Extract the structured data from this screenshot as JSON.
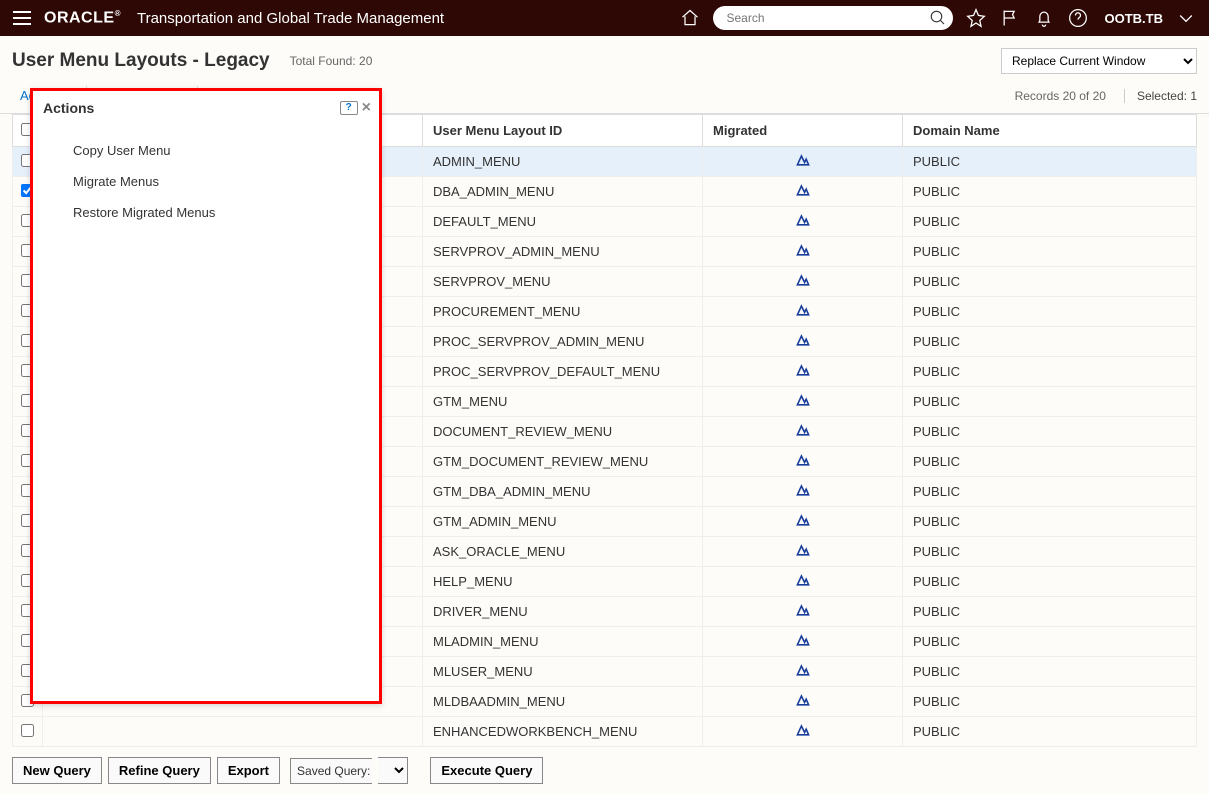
{
  "header": {
    "logo_text": "ORACLE",
    "app_title": "Transportation and Global Trade Management",
    "search_placeholder": "Search",
    "user_label": "OOTB.TB"
  },
  "page": {
    "title": "User Menu Layouts - Legacy",
    "total_found_label": "Total Found:",
    "total_found_value": "20",
    "replace_option": "Replace Current Window"
  },
  "toolbar": {
    "actions_label": "Actions",
    "records_label": "Records 20 of 20",
    "selected_label": "Selected: 1"
  },
  "actions_dropdown": {
    "title": "Actions",
    "help_label": "?",
    "items": [
      {
        "label": "Copy User Menu"
      },
      {
        "label": "Migrate Menus"
      },
      {
        "label": "Restore Migrated Menus"
      }
    ]
  },
  "table": {
    "columns": {
      "id": "User Menu Layout ID",
      "migrated": "Migrated",
      "domain": "Domain Name"
    },
    "rows": [
      {
        "checked": false,
        "id": "ADMIN_MENU",
        "migrated": true,
        "domain": "PUBLIC",
        "highlight": true
      },
      {
        "checked": true,
        "id": "DBA_ADMIN_MENU",
        "migrated": true,
        "domain": "PUBLIC",
        "highlight": false
      },
      {
        "checked": false,
        "id": "DEFAULT_MENU",
        "migrated": true,
        "domain": "PUBLIC",
        "highlight": false
      },
      {
        "checked": false,
        "id": "SERVPROV_ADMIN_MENU",
        "migrated": true,
        "domain": "PUBLIC",
        "highlight": false
      },
      {
        "checked": false,
        "id": "SERVPROV_MENU",
        "migrated": true,
        "domain": "PUBLIC",
        "highlight": false
      },
      {
        "checked": false,
        "id": "PROCUREMENT_MENU",
        "migrated": true,
        "domain": "PUBLIC",
        "highlight": false
      },
      {
        "checked": false,
        "id": "PROC_SERVPROV_ADMIN_MENU",
        "migrated": true,
        "domain": "PUBLIC",
        "highlight": false
      },
      {
        "checked": false,
        "id": "PROC_SERVPROV_DEFAULT_MENU",
        "migrated": true,
        "domain": "PUBLIC",
        "highlight": false
      },
      {
        "checked": false,
        "id": "GTM_MENU",
        "migrated": true,
        "domain": "PUBLIC",
        "highlight": false
      },
      {
        "checked": false,
        "id": "DOCUMENT_REVIEW_MENU",
        "migrated": true,
        "domain": "PUBLIC",
        "highlight": false
      },
      {
        "checked": false,
        "id": "GTM_DOCUMENT_REVIEW_MENU",
        "migrated": true,
        "domain": "PUBLIC",
        "highlight": false
      },
      {
        "checked": false,
        "id": "GTM_DBA_ADMIN_MENU",
        "migrated": true,
        "domain": "PUBLIC",
        "highlight": false
      },
      {
        "checked": false,
        "id": "GTM_ADMIN_MENU",
        "migrated": true,
        "domain": "PUBLIC",
        "highlight": false
      },
      {
        "checked": false,
        "id": "ASK_ORACLE_MENU",
        "migrated": true,
        "domain": "PUBLIC",
        "highlight": false
      },
      {
        "checked": false,
        "id": "HELP_MENU",
        "migrated": true,
        "domain": "PUBLIC",
        "highlight": false
      },
      {
        "checked": false,
        "id": "DRIVER_MENU",
        "migrated": true,
        "domain": "PUBLIC",
        "highlight": false
      },
      {
        "checked": false,
        "id": "MLADMIN_MENU",
        "migrated": true,
        "domain": "PUBLIC",
        "highlight": false
      },
      {
        "checked": false,
        "id": "MLUSER_MENU",
        "migrated": true,
        "domain": "PUBLIC",
        "highlight": false
      },
      {
        "checked": false,
        "id": "MLDBAADMIN_MENU",
        "migrated": true,
        "domain": "PUBLIC",
        "highlight": false
      },
      {
        "checked": false,
        "id": "ENHANCEDWORKBENCH_MENU",
        "migrated": true,
        "domain": "PUBLIC",
        "highlight": false
      }
    ]
  },
  "footer": {
    "new_query": "New Query",
    "refine_query": "Refine Query",
    "export": "Export",
    "saved_query_label": "Saved Query:",
    "execute_query": "Execute Query"
  }
}
